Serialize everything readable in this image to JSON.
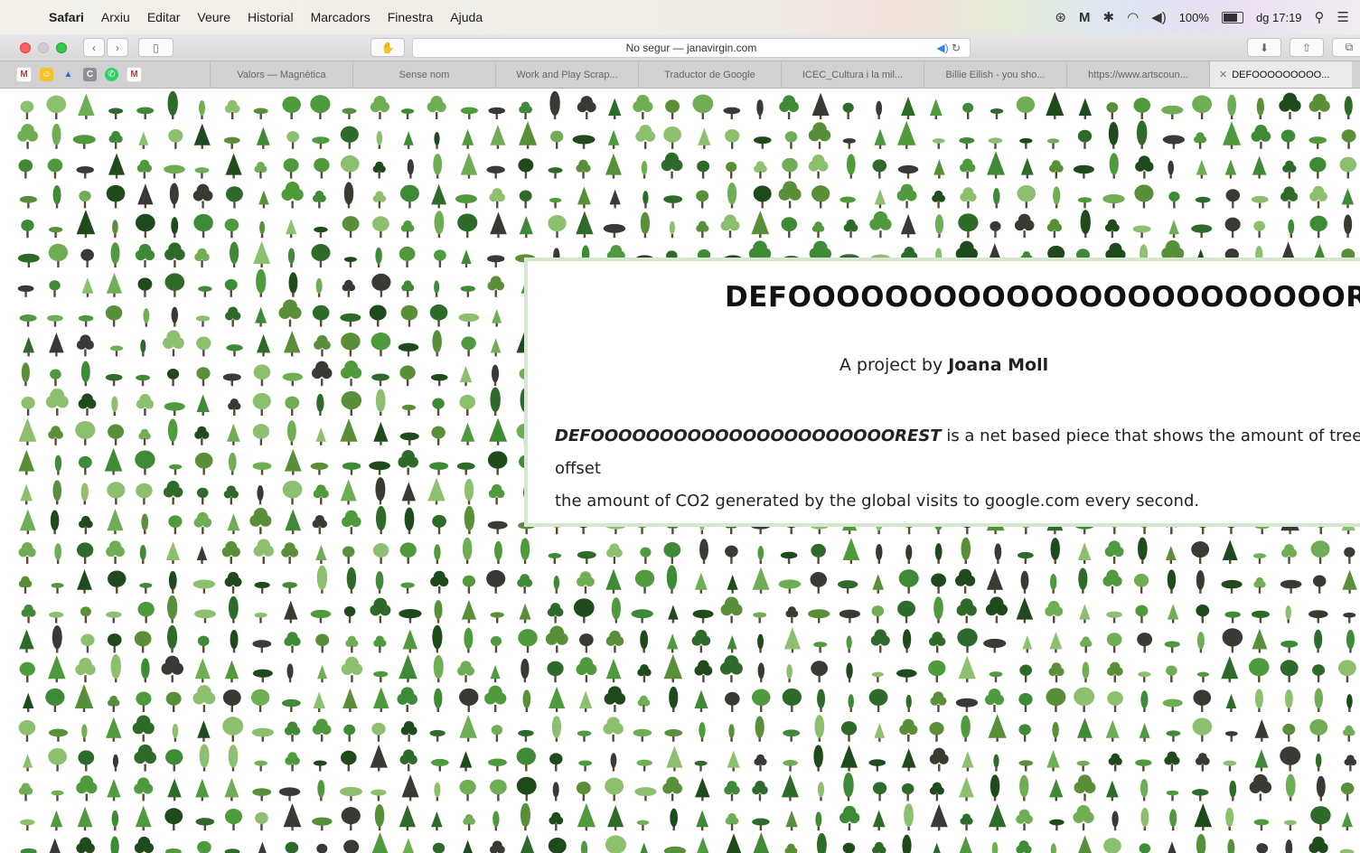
{
  "menubar": {
    "apple_icon": "apple-logo-icon",
    "items": [
      "Safari",
      "Arxiu",
      "Editar",
      "Veure",
      "Historial",
      "Marcadors",
      "Finestra",
      "Ajuda"
    ],
    "status": {
      "battery_percent": "100%",
      "clock": "dg 17:19"
    }
  },
  "toolbar": {
    "address_text": "No segur — janavirgin.com"
  },
  "tabs": {
    "items": [
      "Valors — Magnètica",
      "Sense nom",
      "Work and Play Scrap...",
      "Traductor de Google",
      "ICEC_Cultura i la mil...",
      "Billie Eilish - you sho...",
      "https://www.artscoun...",
      "DEFOOOOOOOOO..."
    ],
    "active_index": 7
  },
  "page": {
    "title": "DEFOOOOOOOOOOOOOOOOOOOOOOOREST",
    "byline_prefix": "A project by",
    "byline_author": "Joana Moll",
    "desc_lead": "DEFOOOOOOOOOOOOOOOOOOOOOOREST",
    "desc_rest": "is a net based piece that shows the amount of trees needed to offset",
    "desc_line2": "the amount of CO2 generated by the global visits to google.com every second."
  },
  "colors": {
    "panel_border": "#d6e7cf",
    "tree_greens": [
      "#2e6b2a",
      "#3f8a36",
      "#4f9a3c",
      "#6fae55",
      "#8cbf6e",
      "#1f4a1c",
      "#3a3a34",
      "#5a8f3a"
    ]
  }
}
